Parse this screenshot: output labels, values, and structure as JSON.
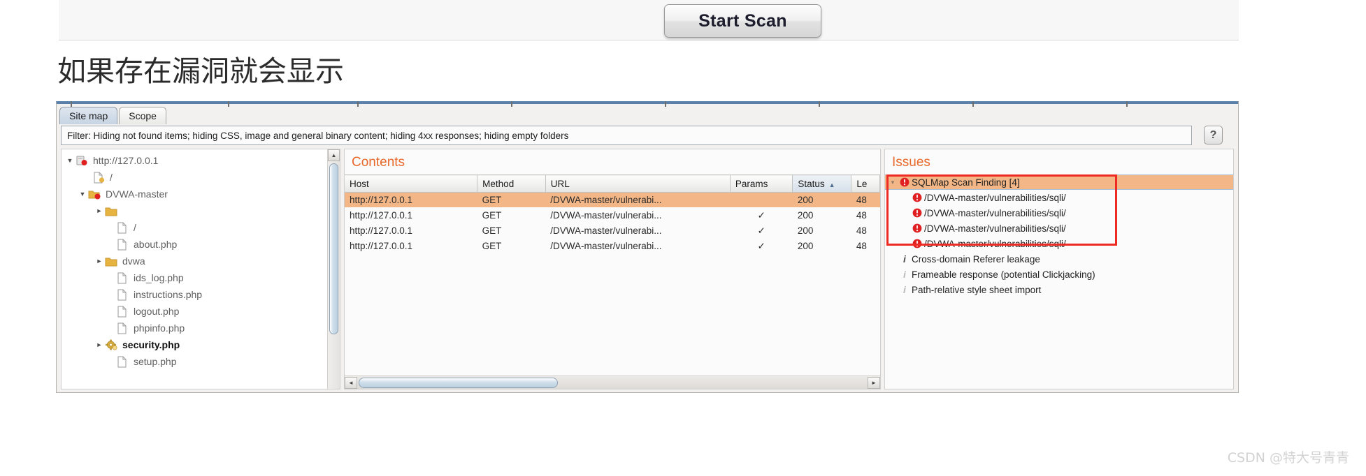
{
  "toolbar": {
    "start_scan_label": "Start Scan"
  },
  "caption": "如果存在漏洞就会显示",
  "burp": {
    "tabs": [
      {
        "label": "Site map",
        "selected": true
      },
      {
        "label": "Scope",
        "selected": false
      }
    ],
    "filter_text": "Filter: Hiding not found items;  hiding CSS, image and general binary content;  hiding 4xx responses;  hiding empty folders",
    "help_label": "?",
    "sitemap": {
      "nodes": [
        {
          "label": "http://127.0.0.1",
          "icon": "host-icon",
          "twist": "▼",
          "indent": 0,
          "bold": false
        },
        {
          "label": "/",
          "icon": "page-flagged-icon",
          "twist": "",
          "indent": 1,
          "bold": false
        },
        {
          "label": "DVWA-master",
          "icon": "folder-flagged-icon",
          "twist": "▼",
          "indent": 1,
          "bold": false
        },
        {
          "label": "",
          "icon": "folder-icon",
          "twist": "►",
          "indent": 2,
          "bold": false
        },
        {
          "label": "/",
          "icon": "page-icon",
          "twist": "",
          "indent": 3,
          "bold": false
        },
        {
          "label": "about.php",
          "icon": "page-icon",
          "twist": "",
          "indent": 3,
          "bold": false
        },
        {
          "label": "dvwa",
          "icon": "folder-icon",
          "twist": "►",
          "indent": 2,
          "bold": false
        },
        {
          "label": "ids_log.php",
          "icon": "page-icon",
          "twist": "",
          "indent": 3,
          "bold": false
        },
        {
          "label": "instructions.php",
          "icon": "page-icon",
          "twist": "",
          "indent": 3,
          "bold": false
        },
        {
          "label": "logout.php",
          "icon": "page-icon",
          "twist": "",
          "indent": 3,
          "bold": false
        },
        {
          "label": "phpinfo.php",
          "icon": "page-icon",
          "twist": "",
          "indent": 3,
          "bold": false
        },
        {
          "label": "security.php",
          "icon": "gear-flagged-icon",
          "twist": "►",
          "indent": 2,
          "bold": true
        },
        {
          "label": "setup.php",
          "icon": "page-icon",
          "twist": "",
          "indent": 3,
          "bold": false
        }
      ],
      "scroll_up_arrow": "▲"
    },
    "contents": {
      "title": "Contents",
      "columns": [
        "Host",
        "Method",
        "URL",
        "Params",
        "Status",
        "Le"
      ],
      "sorted_column": "Status",
      "sort_arrow": "▲",
      "rows": [
        {
          "host": "http://127.0.0.1",
          "method": "GET",
          "url": "/DVWA-master/vulnerabi...",
          "params": "",
          "status": "200",
          "length": "48",
          "highlighted": true
        },
        {
          "host": "http://127.0.0.1",
          "method": "GET",
          "url": "/DVWA-master/vulnerabi...",
          "params": "✓",
          "status": "200",
          "length": "48",
          "highlighted": false
        },
        {
          "host": "http://127.0.0.1",
          "method": "GET",
          "url": "/DVWA-master/vulnerabi...",
          "params": "✓",
          "status": "200",
          "length": "48",
          "highlighted": false
        },
        {
          "host": "http://127.0.0.1",
          "method": "GET",
          "url": "/DVWA-master/vulnerabi...",
          "params": "✓",
          "status": "200",
          "length": "48",
          "highlighted": false
        }
      ],
      "scroll_left_arrow": "◄",
      "scroll_right_arrow": "►"
    },
    "issues": {
      "title": "Issues",
      "rows": [
        {
          "label": "SQLMap Scan Finding [4]",
          "severity": "high",
          "twist": "▼",
          "child": false,
          "selected": true
        },
        {
          "label": "/DVWA-master/vulnerabilities/sqli/",
          "severity": "high",
          "twist": "",
          "child": true,
          "selected": false
        },
        {
          "label": "/DVWA-master/vulnerabilities/sqli/",
          "severity": "high",
          "twist": "",
          "child": true,
          "selected": false
        },
        {
          "label": "/DVWA-master/vulnerabilities/sqli/",
          "severity": "high",
          "twist": "",
          "child": true,
          "selected": false
        },
        {
          "label": "/DVWA-master/vulnerabilities/sqli/",
          "severity": "high",
          "twist": "",
          "child": true,
          "selected": false
        },
        {
          "label": "Cross-domain Referer leakage",
          "severity": "info",
          "twist": "",
          "child": false,
          "selected": false
        },
        {
          "label": "Frameable response (potential Clickjacking)",
          "severity": "info-light",
          "twist": "",
          "child": false,
          "selected": false
        },
        {
          "label": "Path-relative style sheet import",
          "severity": "info-light",
          "twist": "",
          "child": false,
          "selected": false
        }
      ],
      "highlight_box_color": "#ee2a22"
    }
  },
  "watermark": "CSDN @特大号青青",
  "colors": {
    "accent_orange": "#e8692b",
    "row_highlight": "#f3b787",
    "severity_high": "#e02020",
    "annotation_red": "#ee2a22"
  }
}
